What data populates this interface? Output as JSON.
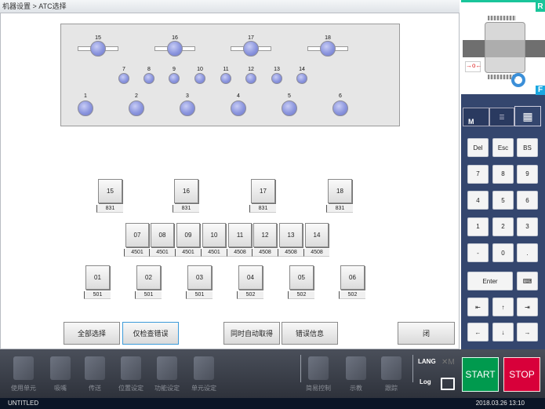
{
  "title": "机器设置 > ATC选择",
  "panel": {
    "large": [
      "15",
      "16",
      "17",
      "18"
    ],
    "small": [
      "7",
      "8",
      "9",
      "10",
      "11",
      "12",
      "13",
      "14"
    ],
    "bottom": [
      "1",
      "2",
      "3",
      "4",
      "5",
      "6"
    ]
  },
  "holders": {
    "row1": [
      {
        "id": "15",
        "val": "831"
      },
      {
        "id": "16",
        "val": "831"
      },
      {
        "id": "17",
        "val": "831"
      },
      {
        "id": "18",
        "val": "831"
      }
    ],
    "row2": [
      {
        "id": "07",
        "val": "4501"
      },
      {
        "id": "08",
        "val": "4501"
      },
      {
        "id": "09",
        "val": "4501"
      },
      {
        "id": "10",
        "val": "4501"
      },
      {
        "id": "11",
        "val": "4508"
      },
      {
        "id": "12",
        "val": "4508"
      },
      {
        "id": "13",
        "val": "4508"
      },
      {
        "id": "14",
        "val": "4508"
      }
    ],
    "row3": [
      {
        "id": "01",
        "val": "501"
      },
      {
        "id": "02",
        "val": "501"
      },
      {
        "id": "03",
        "val": "501"
      },
      {
        "id": "04",
        "val": "502"
      },
      {
        "id": "05",
        "val": "502"
      },
      {
        "id": "06",
        "val": "502"
      }
    ]
  },
  "actions": {
    "select_all": "全部选择",
    "check_errors": "仅检查错误",
    "auto_acquire": "同时自动取得",
    "error_info": "错误信息",
    "close": "闭"
  },
  "side": {
    "rear": "R",
    "front": "F",
    "tab_manual_label": "M"
  },
  "keypad": [
    [
      "Del",
      "Esc",
      "BS"
    ],
    [
      "7",
      "8",
      "9"
    ],
    [
      "4",
      "5",
      "6"
    ],
    [
      "1",
      "2",
      "3"
    ],
    [
      "-",
      "0",
      "."
    ]
  ],
  "keypad_enter": "Enter",
  "keypad_arrows": [
    [
      "⇤",
      "↑",
      "⇥"
    ],
    [
      "←",
      "↓",
      "→"
    ]
  ],
  "toolbar": {
    "left": [
      "使用单元",
      "吸嘴",
      "传送",
      "位置设定",
      "功能设定",
      "单元设定"
    ],
    "mid": [
      "简易控制",
      "示教",
      "跟踪"
    ],
    "lang": "LANG",
    "log": "Log",
    "start": "START",
    "stop": "STOP"
  },
  "colors": {
    "start": "#009a4e",
    "stop": "#d8003a",
    "accent": "#19c59a"
  },
  "status": {
    "file": "UNTITLED",
    "datetime": "2018.03.26 13:10"
  }
}
